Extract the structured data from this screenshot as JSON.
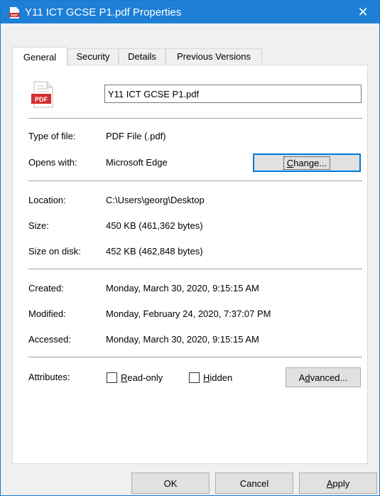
{
  "window": {
    "title": "Y11 ICT GCSE P1.pdf Properties",
    "close_label": "✕"
  },
  "tabs": [
    {
      "label": "General",
      "active": true
    },
    {
      "label": "Security",
      "active": false
    },
    {
      "label": "Details",
      "active": false
    },
    {
      "label": "Previous Versions",
      "active": false
    }
  ],
  "file": {
    "icon": "pdf-file-icon",
    "icon_text": "PDF",
    "name": "Y11 ICT GCSE P1.pdf"
  },
  "type_section": {
    "type_label": "Type of file:",
    "type_value": "PDF File (.pdf)",
    "opens_label": "Opens with:",
    "opens_value": "Microsoft Edge",
    "change_button": {
      "accel": "C",
      "rest": "hange..."
    }
  },
  "location_section": {
    "location_label": "Location:",
    "location_value": "C:\\Users\\georg\\Desktop",
    "size_label": "Size:",
    "size_value": "450 KB (461,362 bytes)",
    "size_on_disk_label": "Size on disk:",
    "size_on_disk_value": "452 KB (462,848 bytes)"
  },
  "dates_section": {
    "created_label": "Created:",
    "created_value": "Monday, March 30, 2020, 9:15:15 AM",
    "modified_label": "Modified:",
    "modified_value": "Monday, February 24, 2020, 7:37:07 PM",
    "accessed_label": "Accessed:",
    "accessed_value": "Monday, March 30, 2020, 9:15:15 AM"
  },
  "attributes": {
    "label": "Attributes:",
    "readonly": {
      "accel": "R",
      "rest": "ead-only",
      "checked": false
    },
    "hidden": {
      "accel": "H",
      "rest": "idden",
      "checked": false
    },
    "advanced_button": {
      "pre": "A",
      "accel": "d",
      "rest": "vanced..."
    }
  },
  "footer": {
    "ok": "OK",
    "cancel": "Cancel",
    "apply": {
      "accel": "A",
      "rest": "pply"
    }
  },
  "colors": {
    "titlebar": "#1e7fd6",
    "pdf_red": "#d32f2f",
    "accent": "#0078d7"
  }
}
